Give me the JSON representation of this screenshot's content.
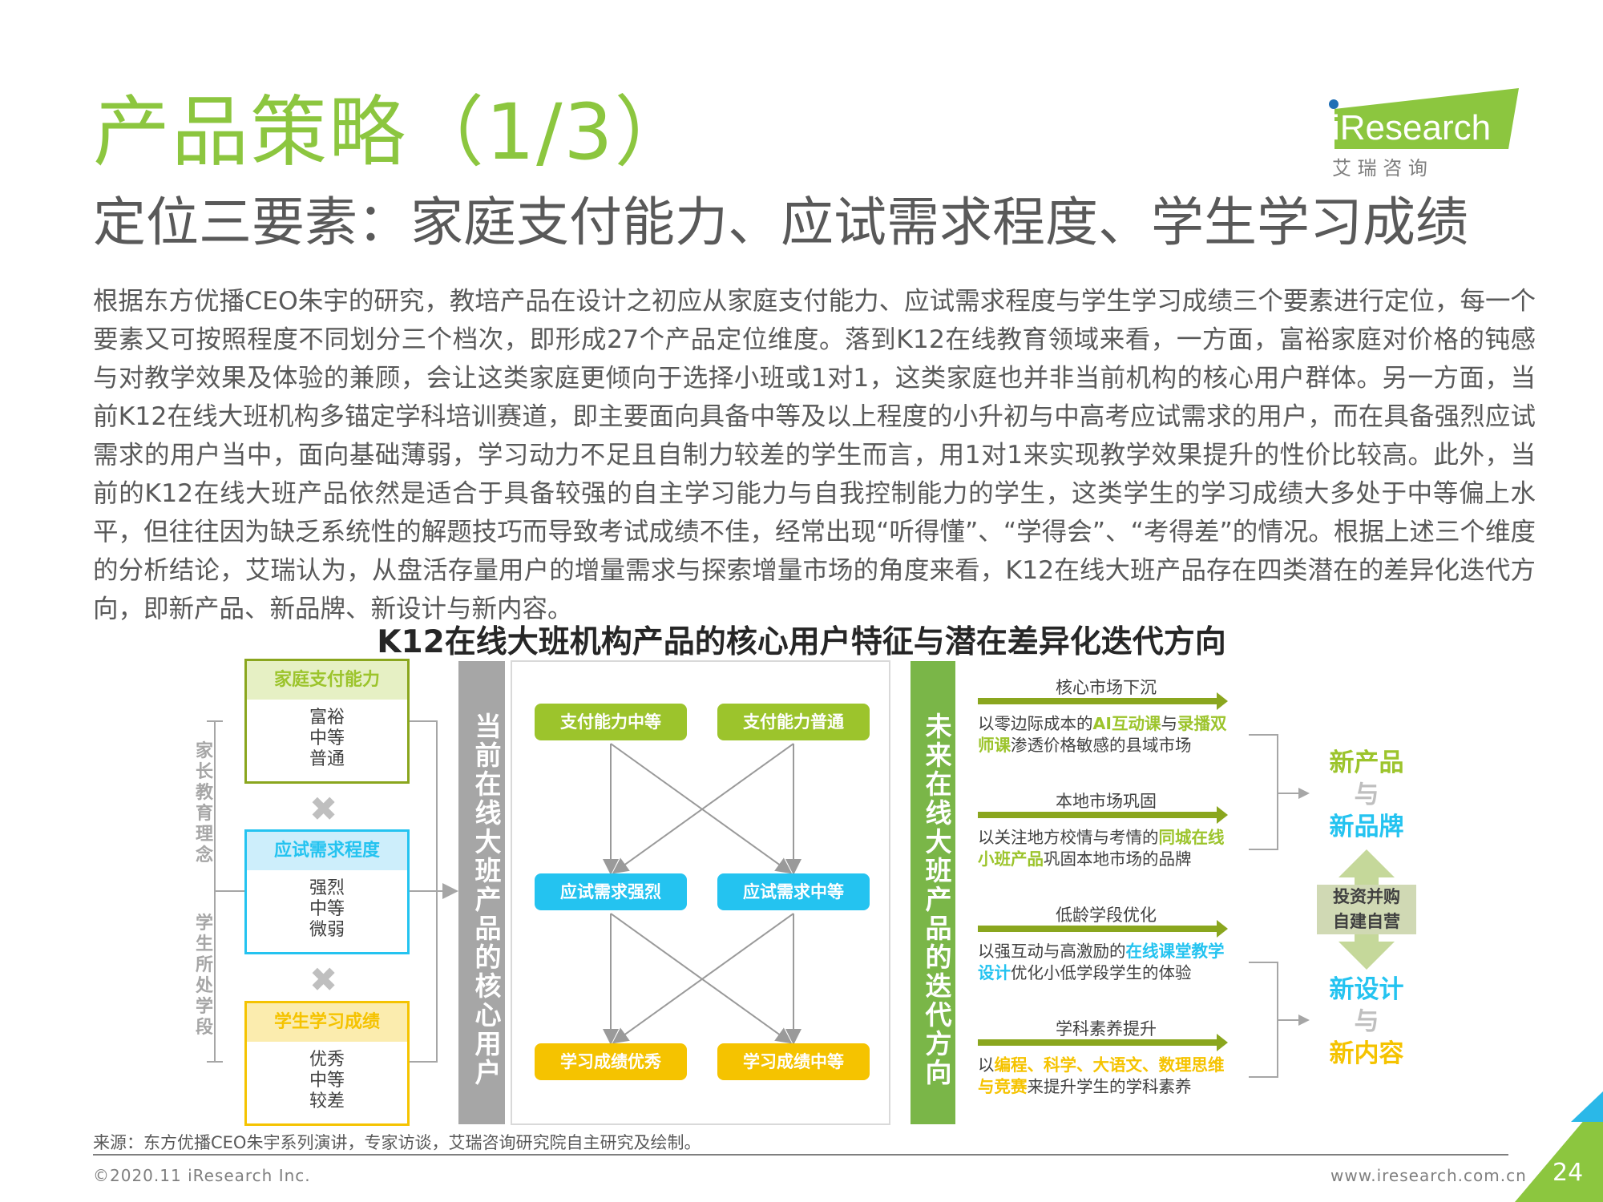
{
  "header": {
    "title": "产品策略（1/3）",
    "subtitle": "定位三要素：家庭支付能力、应试需求程度、学生学习成绩",
    "logo_text": "iResearch",
    "logo_cn": "艾 瑞 咨 询"
  },
  "body_paragraph": "根据东方优播CEO朱宇的研究，教培产品在设计之初应从家庭支付能力、应试需求程度与学生学习成绩三个要素进行定位，每一个要素又可按照程度不同划分三个档次，即形成27个产品定位维度。落到K12在线教育领域来看，一方面，富裕家庭对价格的钝感与对教学效果及体验的兼顾，会让这类家庭更倾向于选择小班或1对1，这类家庭也并非当前机构的核心用户群体。另一方面，当前K12在线大班机构多锚定学科培训赛道，即主要面向具备中等及以上程度的小升初与中高考应试需求的用户，而在具备强烈应试需求的用户当中，面向基础薄弱，学习动力不足且自制力较差的学生而言，用1对1来实现教学效果提升的性价比较高。此外，当前的K12在线大班产品依然是适合于具备较强的自主学习能力与自我控制能力的学生，这类学生的学习成绩大多处于中等偏上水平，但往往因为缺乏系统性的解题技巧而导致考试成绩不佳，经常出现“听得懂”、“学得会”、“考得差”的情况。根据上述三个维度的分析结论，艾瑞认为，从盘活存量用户的增量需求与探索增量市场的角度来看，K12在线大班产品存在四类潜在的差异化迭代方向，即新产品、新品牌、新设计与新内容。",
  "diagram": {
    "title": "K12在线大班机构产品的核心用户特征与潜在差异化迭代方向",
    "side_labels": [
      "家长教育理念",
      "学生所处学段"
    ],
    "factors": [
      {
        "name": "家庭支付能力",
        "levels": [
          "富裕",
          "中等",
          "普通"
        ],
        "color": "#9cc42c"
      },
      {
        "name": "应试需求程度",
        "levels": [
          "强烈",
          "中等",
          "微弱"
        ],
        "color": "#24c3f0"
      },
      {
        "name": "学生学习成绩",
        "levels": [
          "优秀",
          "中等",
          "较差"
        ],
        "color": "#f5c300"
      }
    ],
    "times_symbol": "✖",
    "core_users_bar": "当前在线大班产品的核心用户",
    "pills": [
      {
        "label": "支付能力中等",
        "color": "green"
      },
      {
        "label": "支付能力普通",
        "color": "green"
      },
      {
        "label": "应试需求强烈",
        "color": "blue"
      },
      {
        "label": "应试需求中等",
        "color": "blue"
      },
      {
        "label": "学习成绩优秀",
        "color": "yellow"
      },
      {
        "label": "学习成绩中等",
        "color": "yellow"
      }
    ],
    "future_bar": "未来在线大班产品的迭代方向",
    "directions": [
      {
        "title": "核心市场下沉",
        "desc_parts": [
          [
            "以零边际成本的",
            ""
          ],
          [
            "AI互动课",
            "g"
          ],
          [
            "与",
            ""
          ],
          [
            "录播双师课",
            "g"
          ],
          [
            "渗透价格敏感的县域市场",
            ""
          ]
        ]
      },
      {
        "title": "本地市场巩固",
        "desc_parts": [
          [
            "以关注地方校情与考情的",
            ""
          ],
          [
            "同城在线小班产品",
            "g"
          ],
          [
            "巩固本地市场的品牌",
            ""
          ]
        ]
      },
      {
        "title": "低龄学段优化",
        "desc_parts": [
          [
            "以强互动与高激励的",
            ""
          ],
          [
            "在线课堂教学设计",
            "b"
          ],
          [
            "优化小低学段学生的体验",
            ""
          ]
        ]
      },
      {
        "title": "学科素养提升",
        "desc_parts": [
          [
            "以",
            ""
          ],
          [
            "编程、科学、大语文、数理思维与竞赛",
            "y"
          ],
          [
            "来提升学生的学科素养",
            ""
          ]
        ]
      }
    ],
    "results": {
      "top": [
        "新产品",
        "与",
        "新品牌"
      ],
      "middle": [
        "投资并购",
        "自建自营"
      ],
      "bottom": [
        "新设计",
        "与",
        "新内容"
      ]
    }
  },
  "footer": {
    "source": "来源：东方优播CEO朱宇系列演讲，专家访谈，艾瑞咨询研究院自主研究及绘制。",
    "copyright": "©2020.11 iResearch Inc.",
    "website": "www.iresearch.com.cn",
    "page": "24"
  },
  "colors": {
    "brand_green": "#8cc63f",
    "accent_green": "#9cc42c",
    "accent_blue": "#24c3f0",
    "accent_yellow": "#f5c300",
    "bar_gray": "#a6a6a6",
    "bar_green": "#7ab648",
    "arrow_olive": "#8aa61e"
  }
}
